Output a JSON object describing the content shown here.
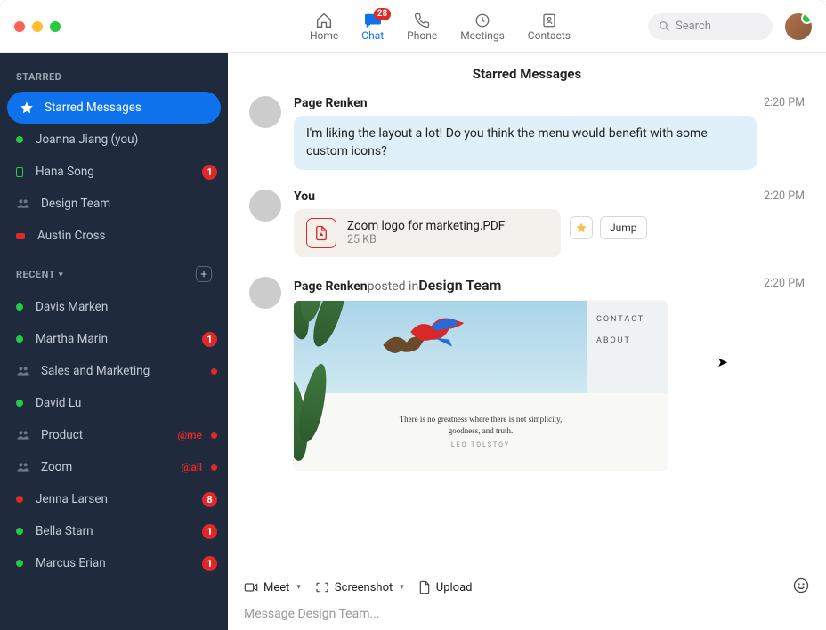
{
  "titlebar": {
    "tabs": {
      "home": "Home",
      "chat": "Chat",
      "phone": "Phone",
      "meetings": "Meetings",
      "contacts": "Contacts"
    },
    "chat_badge": "28",
    "search_placeholder": "Search"
  },
  "sidebar": {
    "sections": {
      "starred_header": "STARRED",
      "recent_header": "RECENT"
    },
    "starred": [
      {
        "label": "Starred Messages"
      },
      {
        "label": "Joanna Jiang (you)"
      },
      {
        "label": "Hana Song",
        "badge": "1"
      },
      {
        "label": "Design Team"
      },
      {
        "label": "Austin Cross"
      }
    ],
    "recent": [
      {
        "label": "Davis Marken"
      },
      {
        "label": "Martha Marin",
        "badge": "1"
      },
      {
        "label": "Sales and Marketing"
      },
      {
        "label": "David Lu"
      },
      {
        "label": "Product",
        "mention": "@me"
      },
      {
        "label": "Zoom",
        "mention": "@all"
      },
      {
        "label": "Jenna Larsen",
        "badge": "8"
      },
      {
        "label": "Bella Starn",
        "badge": "1"
      },
      {
        "label": "Marcus Erian",
        "badge": "1"
      }
    ]
  },
  "main": {
    "title": "Starred Messages",
    "messages": [
      {
        "sender": "Page Renken",
        "time": "2:20 PM",
        "text": "I'm liking the layout a lot! Do you think the menu would benefit with some custom icons?"
      },
      {
        "sender": "You",
        "time": "2:20 PM",
        "file": {
          "name": "Zoom logo for marketing.PDF",
          "size": "25 KB"
        },
        "jump": "Jump"
      },
      {
        "sender": "Page Renken",
        "posted_in_label": " posted in ",
        "channel": "Design Team",
        "time": "2:20 PM",
        "preview": {
          "nav1": "CONTACT",
          "nav2": "ABOUT",
          "quote": "There is no greatness where there is not simplicity, goodness, and truth.",
          "author": "LEO TOLSTOY"
        }
      }
    ]
  },
  "composer": {
    "meet": "Meet",
    "screenshot": "Screenshot",
    "upload": "Upload",
    "placeholder": "Message Design Team..."
  }
}
